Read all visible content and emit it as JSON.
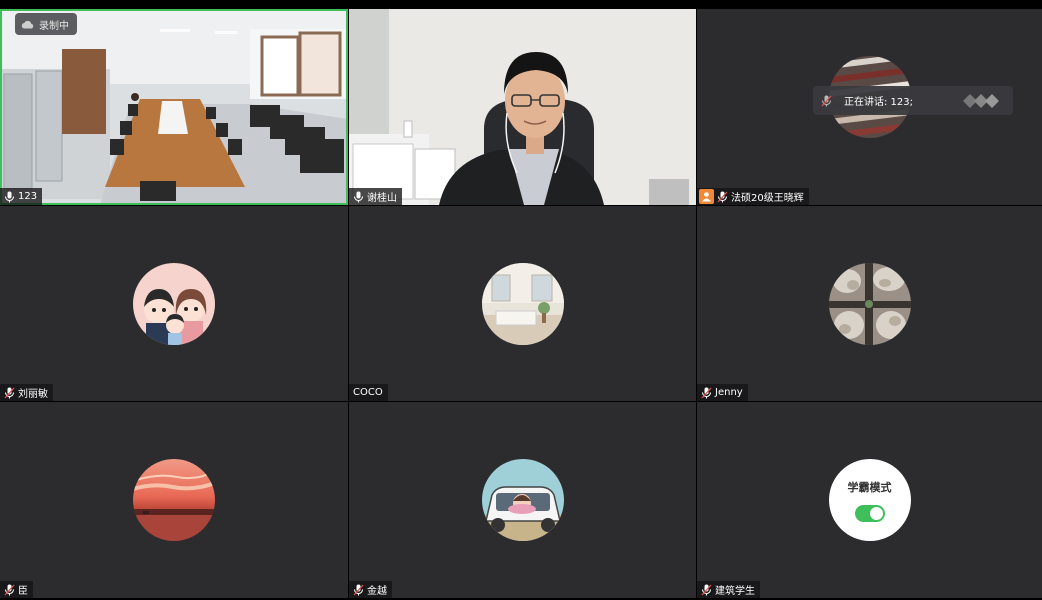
{
  "recording": {
    "label": "录制中",
    "icon": "cloud-icon"
  },
  "speaking": {
    "label": "正在讲话: 123;"
  },
  "tiles": [
    {
      "name": "123",
      "mic": "on",
      "video": "meeting-room"
    },
    {
      "name": "谢桂山",
      "mic": "on",
      "video": "man-in-office"
    },
    {
      "name": "法硕20级王晓辉",
      "mic": "muted",
      "host": true,
      "video": "avatar-textile"
    },
    {
      "name": "刘丽敏",
      "mic": "muted",
      "video": "avatar-cartoon-family"
    },
    {
      "name": "COCO",
      "mic": "none",
      "video": "avatar-room"
    },
    {
      "name": "Jenny",
      "mic": "muted",
      "video": "avatar-stones"
    },
    {
      "name": "臣",
      "mic": "muted",
      "video": "avatar-sunset"
    },
    {
      "name": "金越",
      "mic": "muted",
      "video": "avatar-car"
    },
    {
      "name": "建筑学生",
      "mic": "muted",
      "video": "mode-card"
    }
  ],
  "mode_card": {
    "label": "学霸模式",
    "toggle": "on"
  },
  "colors": {
    "active_border": "#3fbf5b",
    "tile_bg": "#2c2c2e",
    "host_badge": "#f0883a"
  }
}
